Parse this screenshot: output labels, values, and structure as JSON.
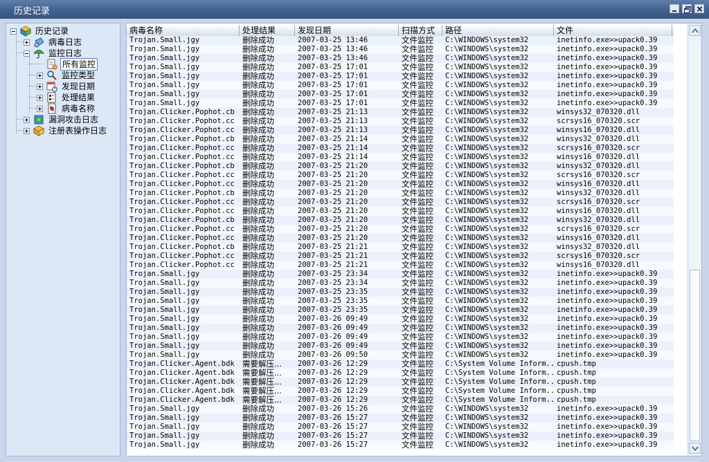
{
  "window": {
    "title": "历史记录"
  },
  "tree": {
    "root": "历史记录",
    "items": [
      {
        "label": "病毒日志"
      },
      {
        "label": "监控日志"
      },
      {
        "label": "所有监控"
      },
      {
        "label": "监控类型"
      },
      {
        "label": "发现日期"
      },
      {
        "label": "处理结果"
      },
      {
        "label": "病毒名称"
      },
      {
        "label": "漏洞攻击日志"
      },
      {
        "label": "注册表操作日志"
      }
    ]
  },
  "table": {
    "columns": [
      "病毒名称",
      "处理结果",
      "发现日期",
      "扫描方式",
      "路径",
      "文件"
    ],
    "rows": [
      [
        "Trojan.Small.jgy",
        "删除成功",
        "2007-03-25 13:46",
        "文件监控",
        "C:\\WINDOWS\\system32",
        "inetinfo.exe>>upack0.39"
      ],
      [
        "Trojan.Small.jgy",
        "删除成功",
        "2007-03-25 13:46",
        "文件监控",
        "C:\\WINDOWS\\system32",
        "inetinfo.exe>>upack0.39"
      ],
      [
        "Trojan.Small.jgy",
        "删除成功",
        "2007-03-25 13:46",
        "文件监控",
        "C:\\WINDOWS\\system32",
        "inetinfo.exe>>upack0.39"
      ],
      [
        "Trojan.Small.jgy",
        "删除成功",
        "2007-03-25 17:01",
        "文件监控",
        "C:\\WINDOWS\\system32",
        "inetinfo.exe>>upack0.39"
      ],
      [
        "Trojan.Small.jgy",
        "删除成功",
        "2007-03-25 17:01",
        "文件监控",
        "C:\\WINDOWS\\system32",
        "inetinfo.exe>>upack0.39"
      ],
      [
        "Trojan.Small.jgy",
        "删除成功",
        "2007-03-25 17:01",
        "文件监控",
        "C:\\WINDOWS\\system32",
        "inetinfo.exe>>upack0.39"
      ],
      [
        "Trojan.Small.jgy",
        "删除成功",
        "2007-03-25 17:01",
        "文件监控",
        "C:\\WINDOWS\\system32",
        "inetinfo.exe>>upack0.39"
      ],
      [
        "Trojan.Small.jgy",
        "删除成功",
        "2007-03-25 17:01",
        "文件监控",
        "C:\\WINDOWS\\system32",
        "inetinfo.exe>>upack0.39"
      ],
      [
        "Trojan.Clicker.Pophot.cb",
        "删除成功",
        "2007-03-25 21:13",
        "文件监控",
        "C:\\WINDOWS\\system32",
        "winsys32_070320.dll"
      ],
      [
        "Trojan.Clicker.Pophot.cc",
        "删除成功",
        "2007-03-25 21:13",
        "文件监控",
        "C:\\WINDOWS\\system32",
        "scrsys16_070320.scr"
      ],
      [
        "Trojan.Clicker.Pophot.cc",
        "删除成功",
        "2007-03-25 21:13",
        "文件监控",
        "C:\\WINDOWS\\system32",
        "winsys16_070320.dll"
      ],
      [
        "Trojan.Clicker.Pophot.cb",
        "删除成功",
        "2007-03-25 21:14",
        "文件监控",
        "C:\\WINDOWS\\system32",
        "winsys32_070320.dll"
      ],
      [
        "Trojan.Clicker.Pophot.cc",
        "删除成功",
        "2007-03-25 21:14",
        "文件监控",
        "C:\\WINDOWS\\system32",
        "scrsys16_070320.scr"
      ],
      [
        "Trojan.Clicker.Pophot.cc",
        "删除成功",
        "2007-03-25 21:14",
        "文件监控",
        "C:\\WINDOWS\\system32",
        "winsys16_070320.dll"
      ],
      [
        "Trojan.Clicker.Pophot.cb",
        "删除成功",
        "2007-03-25 21:20",
        "文件监控",
        "C:\\WINDOWS\\system32",
        "winsys32_070320.dll"
      ],
      [
        "Trojan.Clicker.Pophot.cc",
        "删除成功",
        "2007-03-25 21:20",
        "文件监控",
        "C:\\WINDOWS\\system32",
        "scrsys16_070320.scr"
      ],
      [
        "Trojan.Clicker.Pophot.cc",
        "删除成功",
        "2007-03-25 21:20",
        "文件监控",
        "C:\\WINDOWS\\system32",
        "winsys16_070320.dll"
      ],
      [
        "Trojan.Clicker.Pophot.cb",
        "删除成功",
        "2007-03-25 21:20",
        "文件监控",
        "C:\\WINDOWS\\system32",
        "winsys32_070320.dll"
      ],
      [
        "Trojan.Clicker.Pophot.cc",
        "删除成功",
        "2007-03-25 21:20",
        "文件监控",
        "C:\\WINDOWS\\system32",
        "scrsys16_070320.scr"
      ],
      [
        "Trojan.Clicker.Pophot.cc",
        "删除成功",
        "2007-03-25 21:20",
        "文件监控",
        "C:\\WINDOWS\\system32",
        "winsys16_070320.dll"
      ],
      [
        "Trojan.Clicker.Pophot.cb",
        "删除成功",
        "2007-03-25 21:20",
        "文件监控",
        "C:\\WINDOWS\\system32",
        "winsys32_070320.dll"
      ],
      [
        "Trojan.Clicker.Pophot.cc",
        "删除成功",
        "2007-03-25 21:20",
        "文件监控",
        "C:\\WINDOWS\\system32",
        "scrsys16_070320.scr"
      ],
      [
        "Trojan.Clicker.Pophot.cc",
        "删除成功",
        "2007-03-25 21:20",
        "文件监控",
        "C:\\WINDOWS\\system32",
        "winsys16_070320.dll"
      ],
      [
        "Trojan.Clicker.Pophot.cb",
        "删除成功",
        "2007-03-25 21:21",
        "文件监控",
        "C:\\WINDOWS\\system32",
        "winsys32_070320.dll"
      ],
      [
        "Trojan.Clicker.Pophot.cc",
        "删除成功",
        "2007-03-25 21:21",
        "文件监控",
        "C:\\WINDOWS\\system32",
        "scrsys16_070320.scr"
      ],
      [
        "Trojan.Clicker.Pophot.cc",
        "删除成功",
        "2007-03-25 21:21",
        "文件监控",
        "C:\\WINDOWS\\system32",
        "winsys16_070320.dll"
      ],
      [
        "Trojan.Small.jgy",
        "删除成功",
        "2007-03-25 23:34",
        "文件监控",
        "C:\\WINDOWS\\system32",
        "inetinfo.exe>>upack0.39"
      ],
      [
        "Trojan.Small.jgy",
        "删除成功",
        "2007-03-25 23:34",
        "文件监控",
        "C:\\WINDOWS\\system32",
        "inetinfo.exe>>upack0.39"
      ],
      [
        "Trojan.Small.jgy",
        "删除成功",
        "2007-03-25 23:35",
        "文件监控",
        "C:\\WINDOWS\\system32",
        "inetinfo.exe>>upack0.39"
      ],
      [
        "Trojan.Small.jgy",
        "删除成功",
        "2007-03-25 23:35",
        "文件监控",
        "C:\\WINDOWS\\system32",
        "inetinfo.exe>>upack0.39"
      ],
      [
        "Trojan.Small.jgy",
        "删除成功",
        "2007-03-25 23:35",
        "文件监控",
        "C:\\WINDOWS\\system32",
        "inetinfo.exe>>upack0.39"
      ],
      [
        "Trojan.Small.jgy",
        "删除成功",
        "2007-03-26 09:49",
        "文件监控",
        "C:\\WINDOWS\\system32",
        "inetinfo.exe>>upack0.39"
      ],
      [
        "Trojan.Small.jgy",
        "删除成功",
        "2007-03-26 09:49",
        "文件监控",
        "C:\\WINDOWS\\system32",
        "inetinfo.exe>>upack0.39"
      ],
      [
        "Trojan.Small.jgy",
        "删除成功",
        "2007-03-26 09:49",
        "文件监控",
        "C:\\WINDOWS\\system32",
        "inetinfo.exe>>upack0.39"
      ],
      [
        "Trojan.Small.jgy",
        "删除成功",
        "2007-03-26 09:49",
        "文件监控",
        "C:\\WINDOWS\\system32",
        "inetinfo.exe>>upack0.39"
      ],
      [
        "Trojan.Small.jgy",
        "删除成功",
        "2007-03-26 09:50",
        "文件监控",
        "C:\\WINDOWS\\system32",
        "inetinfo.exe>>upack0.39"
      ],
      [
        "Trojan.Clicker.Agent.bdk",
        "需要解压...",
        "2007-03-26 12:29",
        "文件监控",
        "C:\\System Volume Inform...",
        "cpush.tmp"
      ],
      [
        "Trojan.Clicker.Agent.bdk",
        "需要解压...",
        "2007-03-26 12:29",
        "文件监控",
        "C:\\System Volume Inform...",
        "cpush.tmp"
      ],
      [
        "Trojan.Clicker.Agent.bdk",
        "需要解压...",
        "2007-03-26 12:29",
        "文件监控",
        "C:\\System Volume Inform...",
        "cpush.tmp"
      ],
      [
        "Trojan.Clicker.Agent.bdk",
        "需要解压...",
        "2007-03-26 12:29",
        "文件监控",
        "C:\\System Volume Inform...",
        "cpush.tmp"
      ],
      [
        "Trojan.Clicker.Agent.bdk",
        "需要解压...",
        "2007-03-26 12:29",
        "文件监控",
        "C:\\System Volume Inform...",
        "cpush.tmp"
      ],
      [
        "Trojan.Small.jgy",
        "删除成功",
        "2007-03-26 15:26",
        "文件监控",
        "C:\\WINDOWS\\system32",
        "inetinfo.exe>>upack0.39"
      ],
      [
        "Trojan.Small.jgy",
        "删除成功",
        "2007-03-26 15:27",
        "文件监控",
        "C:\\WINDOWS\\system32",
        "inetinfo.exe>>upack0.39"
      ],
      [
        "Trojan.Small.jgy",
        "删除成功",
        "2007-03-26 15:27",
        "文件监控",
        "C:\\WINDOWS\\system32",
        "inetinfo.exe>>upack0.39"
      ],
      [
        "Trojan.Small.jgy",
        "删除成功",
        "2007-03-26 15:27",
        "文件监控",
        "C:\\WINDOWS\\system32",
        "inetinfo.exe>>upack0.39"
      ],
      [
        "Trojan.Small.jgy",
        "删除成功",
        "2007-03-26 15:27",
        "文件监控",
        "C:\\WINDOWS\\system32",
        "inetinfo.exe>>upack0.39"
      ]
    ]
  },
  "icons": {
    "root": "history-log-icon",
    "virus_log": "virus-log-icon",
    "monitor_log": "monitor-umbrella-icon",
    "all_monitor": "document-icon",
    "monitor_type": "magnifier-icon",
    "found_date": "calendar-icon",
    "result": "result-list-icon",
    "virus_name": "virus-name-icon",
    "exploit_log": "exploit-log-icon",
    "registry_log": "registry-log-icon"
  },
  "colors": {
    "title_bar": "#3f5f8c",
    "frame_bg": "#c9d6ea",
    "row_alt": "#eaf1fb",
    "selection_border": "#5e7fb4"
  }
}
